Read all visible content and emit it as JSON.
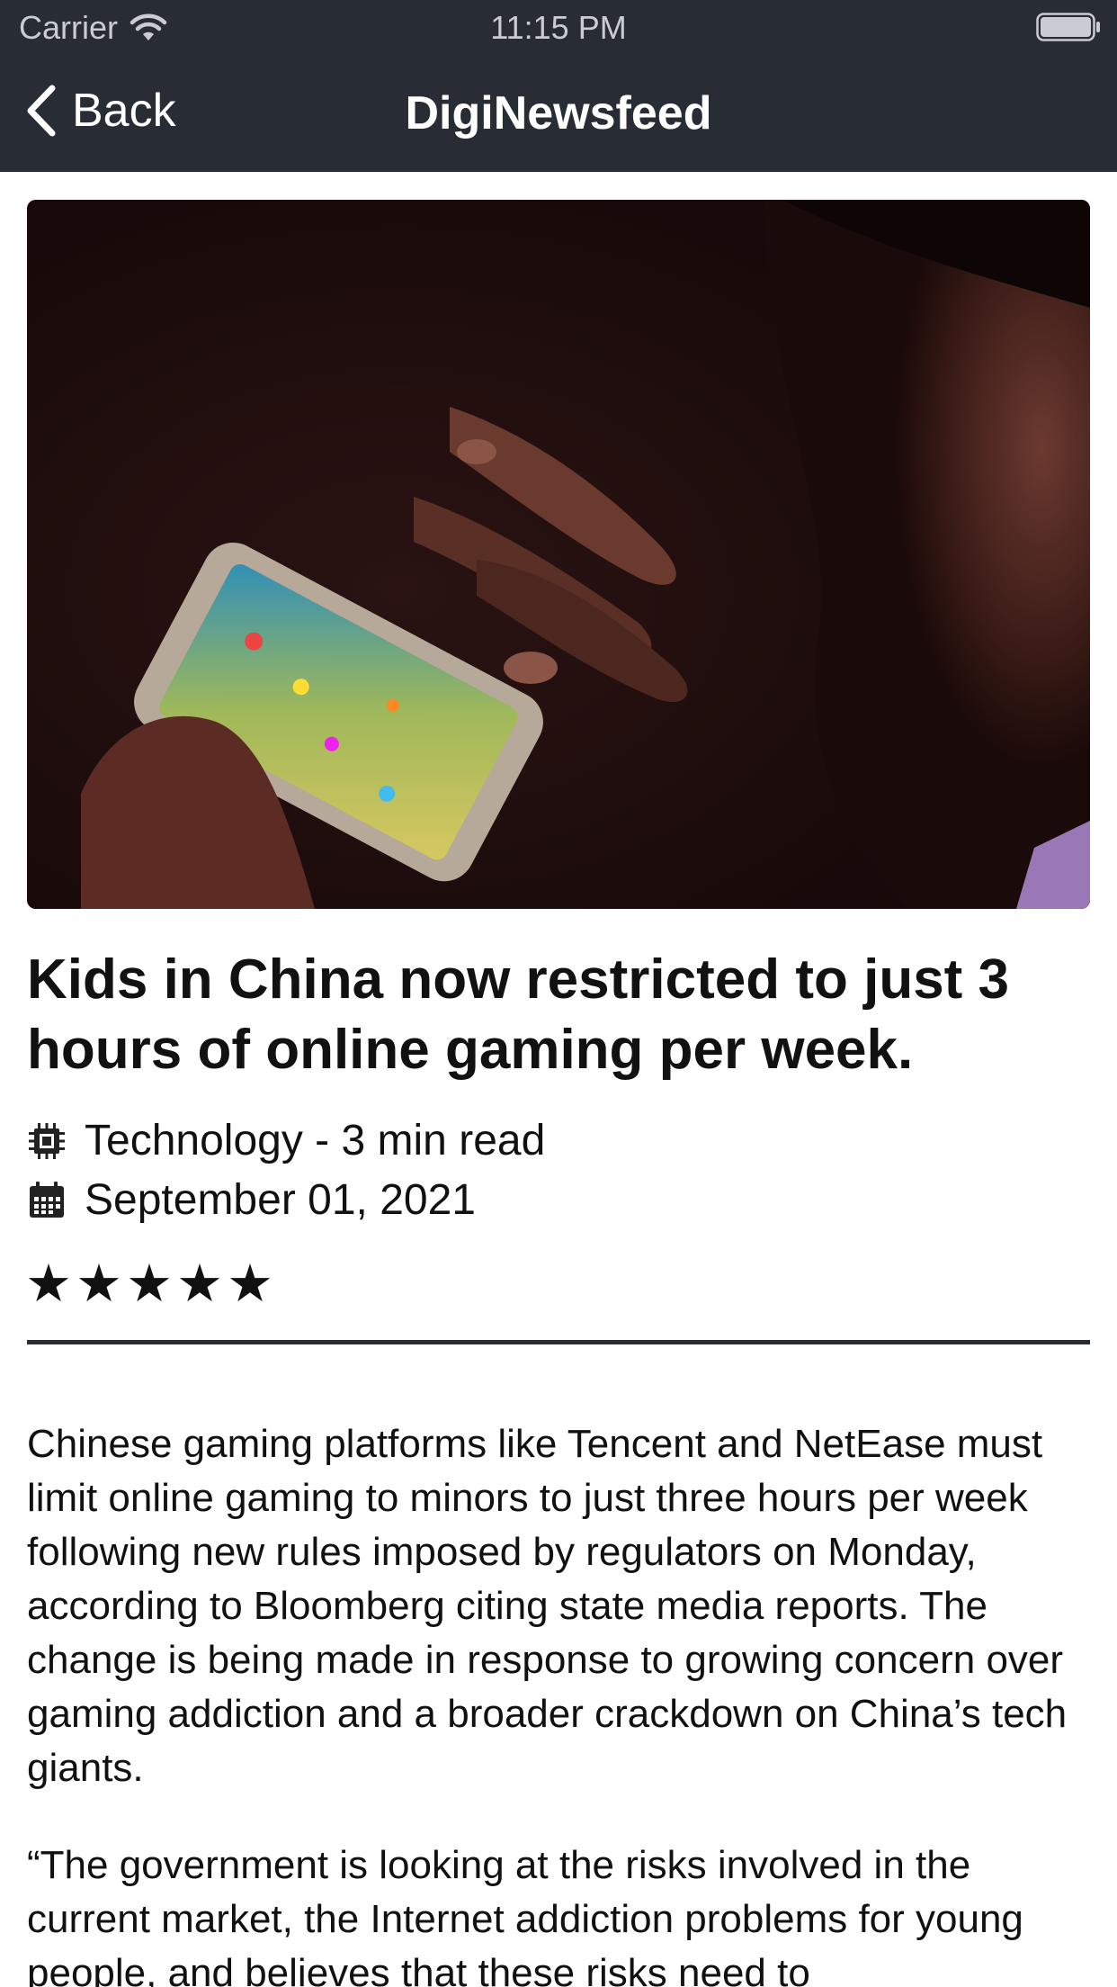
{
  "status_bar": {
    "carrier": "Carrier",
    "time": "11:15 PM"
  },
  "nav": {
    "back_label": "Back",
    "title": "DigiNewsfeed"
  },
  "article": {
    "image_icon": "child-playing-phone-photo",
    "headline": "Kids in China now restricted to just 3 hours of online gaming per week.",
    "category_line": "Technology - 3 min read",
    "category_icon": "cpu-chip-icon",
    "date": "September 01, 2021",
    "date_icon": "calendar-icon",
    "rating": 5,
    "rating_max": 5,
    "paragraphs": [
      "Chinese gaming platforms like Tencent and NetEase must limit online gaming to minors to just three hours per week following new rules imposed by regulators on Monday, according to Bloomberg citing state media reports. The change is being made in response to growing concern over gaming addiction and a broader crackdown on China’s tech giants.",
      "“The government is looking at the risks involved in the current market, the Internet addiction problems for young people, and believes that these risks need to"
    ]
  },
  "colors": {
    "nav_background": "#272c35",
    "page_background": "#ffffff",
    "text": "#111111"
  }
}
